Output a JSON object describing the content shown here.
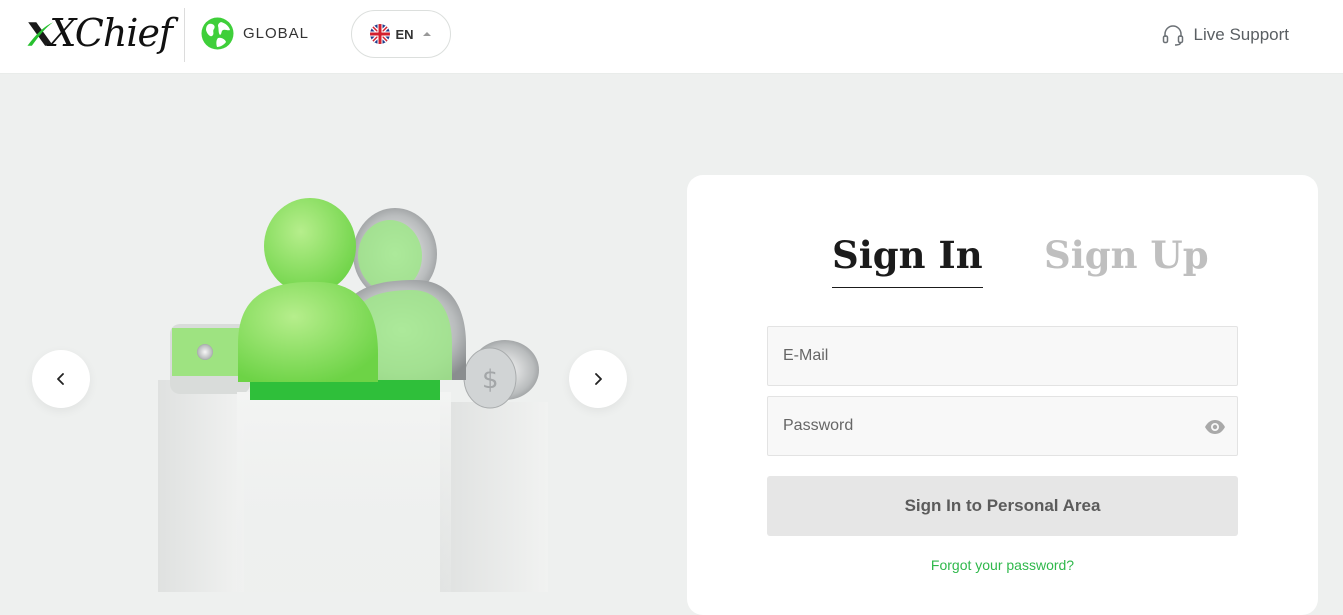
{
  "header": {
    "brand": "XChief",
    "region_label": "GLOBAL",
    "language": {
      "code": "EN",
      "flag_icon": "uk-flag-icon"
    },
    "support_label": "Live Support"
  },
  "carousel": {
    "prev_icon": "chevron-left-icon",
    "next_icon": "chevron-right-icon"
  },
  "auth": {
    "tabs": [
      {
        "label": "Sign In",
        "active": true
      },
      {
        "label": "Sign Up",
        "active": false
      }
    ],
    "email": {
      "placeholder": "E-Mail",
      "value": ""
    },
    "password": {
      "placeholder": "Password",
      "value": "",
      "toggle_icon": "eye-icon"
    },
    "submit_label": "Sign In to Personal Area",
    "forgot_label": "Forgot your password?"
  },
  "colors": {
    "accent_green": "#2fb84b",
    "logo_green": "#27c02f",
    "page_bg": "#eef0ef",
    "text_dark": "#1b1b1b",
    "tab_inactive": "#bfbfbf"
  }
}
